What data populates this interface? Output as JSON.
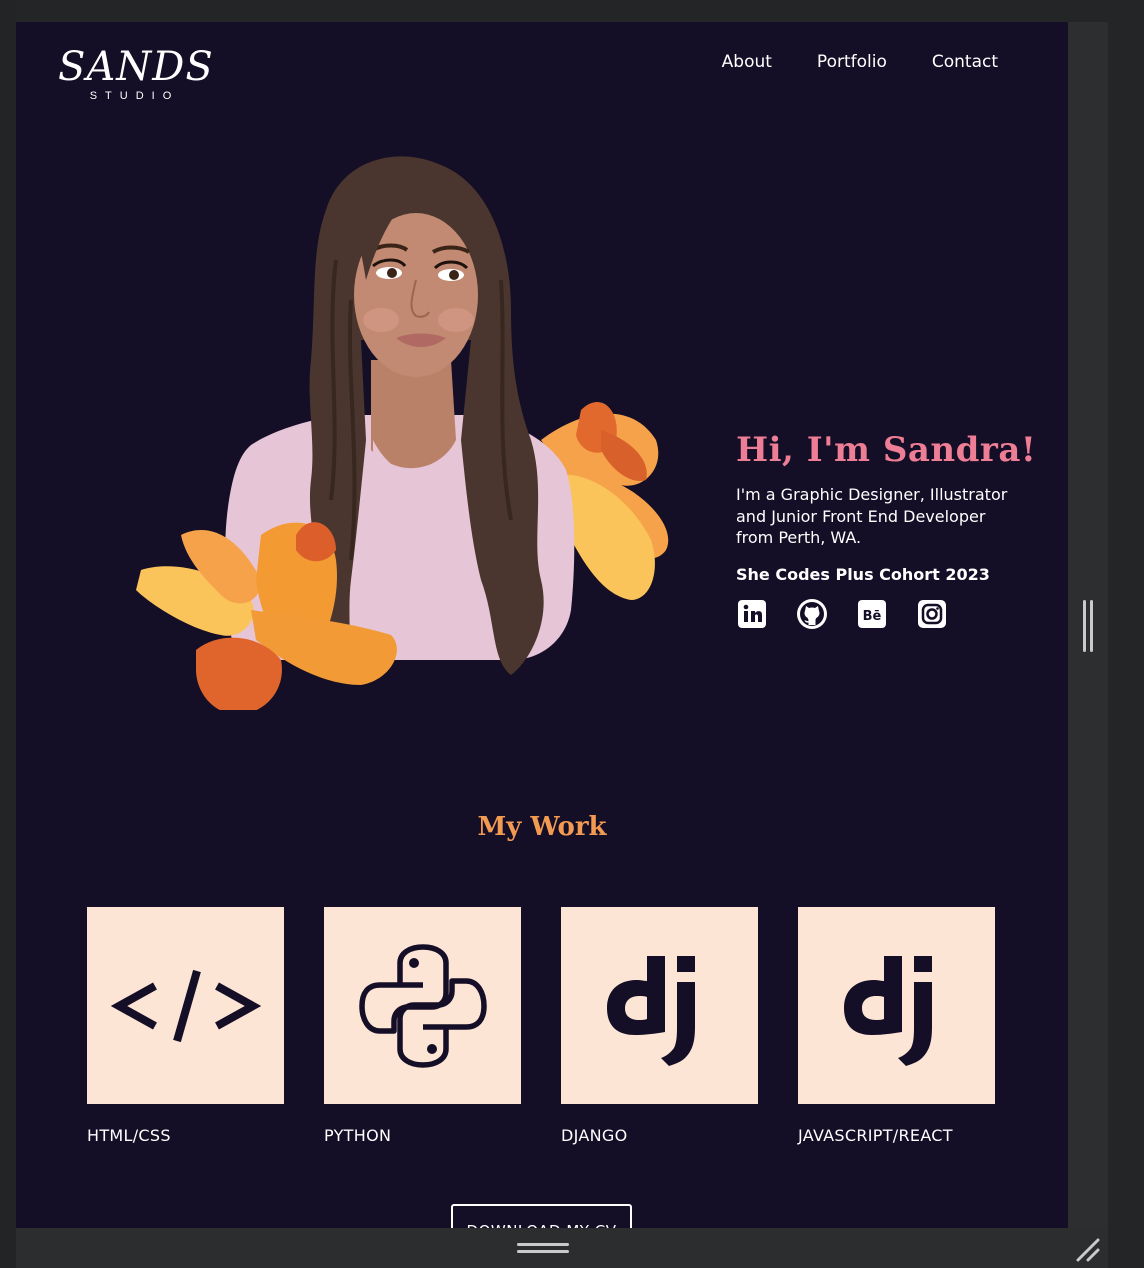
{
  "header": {
    "logo_main": "SANDS",
    "logo_sub": "STUDIO",
    "nav": [
      {
        "label": "About"
      },
      {
        "label": "Portfolio"
      },
      {
        "label": "Contact"
      }
    ]
  },
  "hero": {
    "title": "Hi, I'm Sandra!",
    "description": "I'm a Graphic Designer, Illustrator and Junior Front End Developer from Perth, WA.",
    "cohort": "She Codes Plus Cohort 2023",
    "socials": [
      {
        "icon": "linkedin-icon"
      },
      {
        "icon": "github-icon"
      },
      {
        "icon": "behance-icon"
      },
      {
        "icon": "instagram-icon"
      }
    ]
  },
  "work": {
    "title": "My Work",
    "cards": [
      {
        "label": "HTML/CSS",
        "icon": "code-icon"
      },
      {
        "label": "PYTHON",
        "icon": "python-icon"
      },
      {
        "label": "DJANGO",
        "icon": "django-icon"
      },
      {
        "label": "JAVASCRIPT/REACT",
        "icon": "django-icon"
      }
    ],
    "cv_button": "DOWNLOAD MY CV"
  },
  "colors": {
    "background": "#140e26",
    "accent_pink": "#ee7e95",
    "accent_orange": "#f39a52",
    "card_bg": "#fde5d6"
  }
}
